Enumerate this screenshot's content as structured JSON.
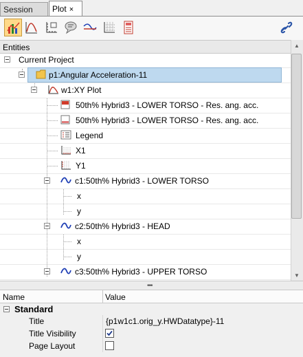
{
  "tabs": [
    {
      "label": "Session",
      "active": false
    },
    {
      "label": "Plot",
      "active": true,
      "close": "×"
    }
  ],
  "toolbar": {
    "icons": [
      "plot-toolbar-icon",
      "curve-icon",
      "axes-icon",
      "note-icon",
      "datum-icon",
      "grid-icon",
      "page-icon",
      "link-icon"
    ],
    "selected_index": 0
  },
  "entities": {
    "header": "Entities",
    "root": "Current Project",
    "page": "p1:Angular Acceleration-11",
    "window": "w1:XY Plot",
    "items": [
      "50th% Hybrid3  - LOWER TORSO - Res. ang. acc.",
      "50th% Hybrid3  - LOWER TORSO - Res. ang. acc.",
      "Legend",
      "X1",
      "Y1"
    ],
    "curves": [
      {
        "label": "c1:50th% Hybrid3  - LOWER TORSO",
        "x": "x",
        "y": "y"
      },
      {
        "label": "c2:50th% Hybrid3  - HEAD",
        "x": "x",
        "y": "y"
      },
      {
        "label": "c3:50th% Hybrid3  - UPPER TORSO"
      }
    ]
  },
  "grip": "•••",
  "properties": {
    "col_name": "Name",
    "col_value": "Value",
    "category": "Standard",
    "rows": [
      {
        "name": "Title",
        "value": "{p1w1c1.orig_y.HWDatatype}-11"
      },
      {
        "name": "Title Visibility",
        "checked": true
      },
      {
        "name": "Page Layout",
        "checked": false
      }
    ]
  },
  "colors": {
    "selection_bg": "#bed9ef",
    "curve_blue": "#1f3fb5",
    "toolbar_selected": "#ffd98a"
  }
}
